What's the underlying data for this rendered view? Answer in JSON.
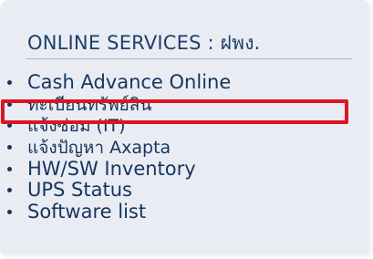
{
  "panel": {
    "title": "ONLINE SERVICES : ฝพง."
  },
  "links": [
    {
      "label": "Cash Advance Online"
    },
    {
      "label": "ทะเบียนทรัพย์สิน"
    },
    {
      "label": "แจ้งซ่อม (IT)"
    },
    {
      "label": "แจ้งปัญหา Axapta"
    },
    {
      "label": "HW/SW Inventory"
    },
    {
      "label": "UPS Status"
    },
    {
      "label": "Software list"
    }
  ],
  "colors": {
    "panel_background": "#e9edf3",
    "link_text": "#16345f",
    "highlight": "#e0141e"
  }
}
